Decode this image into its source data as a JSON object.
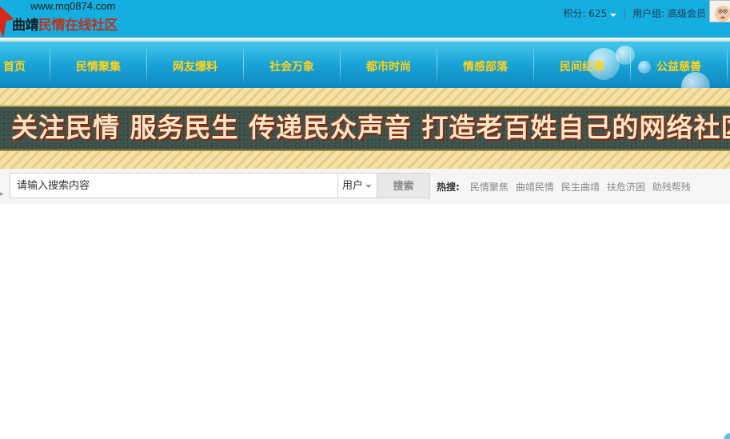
{
  "header": {
    "site_url": "www.mq0874.com",
    "logo_first": "曲靖",
    "logo_rest": "民情在线社区",
    "points_label": "积分: 625",
    "group_label": "用户组: 高级会员",
    "colors": {
      "header_bg": "#14aee0",
      "nav_text": "#ffd11a"
    }
  },
  "nav": {
    "items": [
      "首页",
      "民情聚集",
      "网友爆料",
      "社会万象",
      "都市时尚",
      "情感部落",
      "民间纪事",
      "公益慈善"
    ]
  },
  "banner": {
    "slogan": "关注民情 服务民生 传递民众声音 打造老百姓自己的网络社区"
  },
  "search": {
    "placeholder": "请输入搜索内容",
    "type_value": "用户",
    "button_label": "搜索",
    "hot_label": "热搜:",
    "hot_terms": [
      "民情聚焦",
      "曲靖民情",
      "民生曲靖",
      "扶危济困",
      "助残帮残"
    ]
  }
}
